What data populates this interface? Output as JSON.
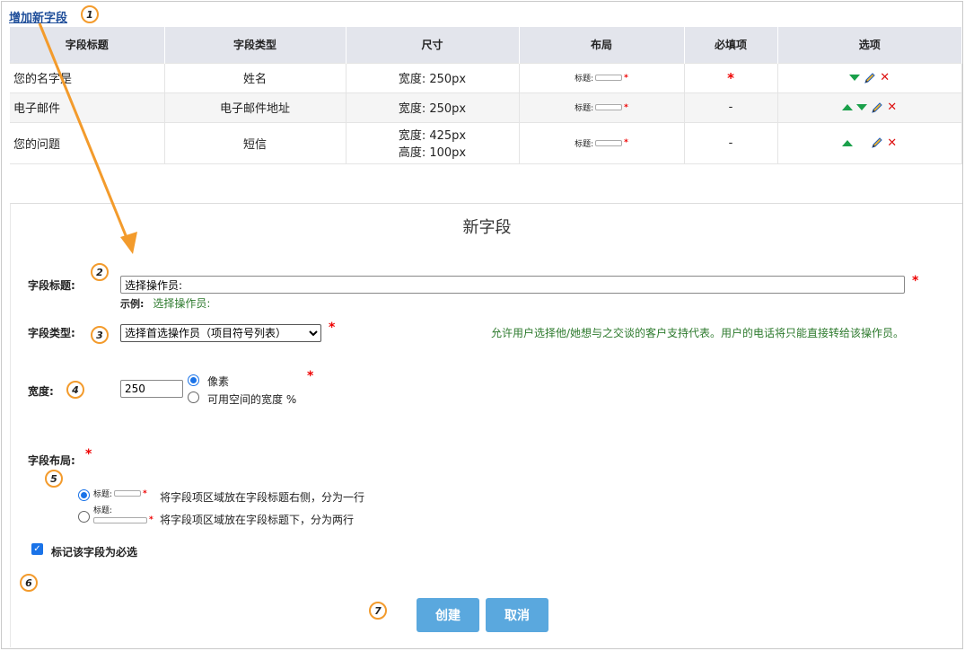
{
  "add_field_link": "增加新字段",
  "callouts": [
    "1",
    "2",
    "3",
    "4",
    "5",
    "6",
    "7"
  ],
  "table": {
    "headers": [
      "字段标题",
      "字段类型",
      "尺寸",
      "布局",
      "必填项",
      "选项"
    ],
    "rows": [
      {
        "title": "您的名字是",
        "type": "姓名",
        "size1": "宽度: 250px",
        "size2": "",
        "layout_label": "标题:",
        "required": "*"
      },
      {
        "title": "电子邮件",
        "type": "电子邮件地址",
        "size1": "宽度: 250px",
        "size2": "",
        "layout_label": "标题:",
        "required": "-"
      },
      {
        "title": "您的问题",
        "type": "短信",
        "size1": "宽度: 425px",
        "size2": "高度: 100px",
        "layout_label": "标题:",
        "required": "-"
      }
    ]
  },
  "form": {
    "title": "新字段",
    "field_title_label": "字段标题:",
    "field_title_value": "选择操作员:",
    "example_label": "示例:",
    "example_value": "选择操作员:",
    "field_type_label": "字段类型:",
    "field_type_selected": "选择首选操作员（项目符号列表）",
    "field_type_help": "允许用户选择他/她想与之交谈的客户支持代表。用户的电话将只能直接转给该操作员。",
    "width_label": "宽度:",
    "width_value": "250",
    "width_unit_pixels": "像素",
    "width_unit_percent": "可用空间的宽度 %",
    "layout_label": "字段布局:",
    "layout_mini_label": "标题:",
    "layout_option1": "将字段项区域放在字段标题右侧，分为一行",
    "layout_option2": "将字段项区域放在字段标题下，分为两行",
    "required_checkbox_label": "标记该字段为必选",
    "create_button": "创建",
    "cancel_button": "取消"
  },
  "colors": {
    "accent": "#1a73e8",
    "button": "#5aa8de",
    "callout": "#f39b2c",
    "required": "#e00000",
    "help": "#2d7a2d"
  }
}
